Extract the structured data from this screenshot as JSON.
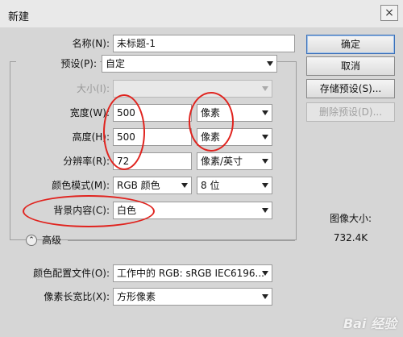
{
  "window": {
    "title": "新建",
    "close_glyph": "×"
  },
  "form": {
    "name_label": "名称(N):",
    "name_value": "未标题-1",
    "preset_label": "预设(P):",
    "preset_value": "自定",
    "size_label": "大小(I):",
    "size_value": "",
    "width_label": "宽度(W):",
    "width_value": "500",
    "width_unit": "像素",
    "height_label": "高度(H):",
    "height_value": "500",
    "height_unit": "像素",
    "resolution_label": "分辨率(R):",
    "resolution_value": "72",
    "resolution_unit": "像素/英寸",
    "color_mode_label": "颜色模式(M):",
    "color_mode_value": "RGB 颜色",
    "bit_depth_value": "8 位",
    "background_label": "背景内容(C):",
    "background_value": "白色",
    "advanced_label": "高级",
    "advanced_glyph": "⌃",
    "color_profile_label": "颜色配置文件(O):",
    "color_profile_value": "工作中的 RGB: sRGB IEC6196...",
    "pixel_aspect_label": "像素长宽比(X):",
    "pixel_aspect_value": "方形像素"
  },
  "buttons": {
    "ok": "确定",
    "cancel": "取消",
    "save_preset": "存储预设(S)...",
    "delete_preset": "删除预设(D)..."
  },
  "info": {
    "image_size_label": "图像大小:",
    "image_size_value": "732.4K"
  },
  "annotation_color": "#e0231e",
  "watermark": "Bai 经验"
}
